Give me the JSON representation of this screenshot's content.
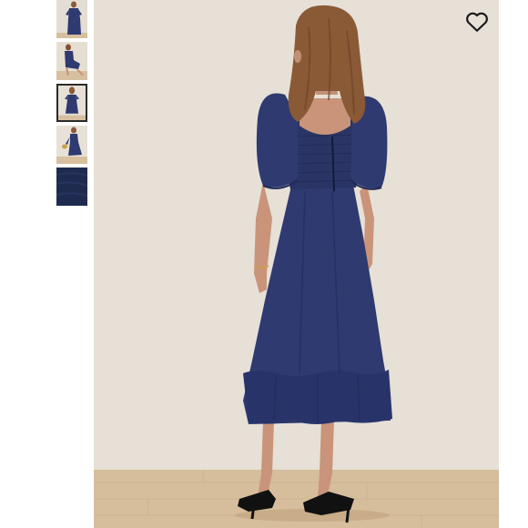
{
  "product_gallery": {
    "thumbnails": [
      {
        "name": "front-view"
      },
      {
        "name": "seated-view"
      },
      {
        "name": "back-view",
        "selected": true
      },
      {
        "name": "walking-view"
      },
      {
        "name": "fabric-swatch"
      }
    ],
    "main_image": {
      "view": "back-view"
    },
    "wishlist_icon": "heart-outline-icon"
  },
  "colors": {
    "dress_navy": "#2e3a70",
    "dress_shadow": "#222b58",
    "wall": "#e6e0d7",
    "floor": "#d7bf9f",
    "skin": "#c99479",
    "hair": "#8a5a37"
  }
}
